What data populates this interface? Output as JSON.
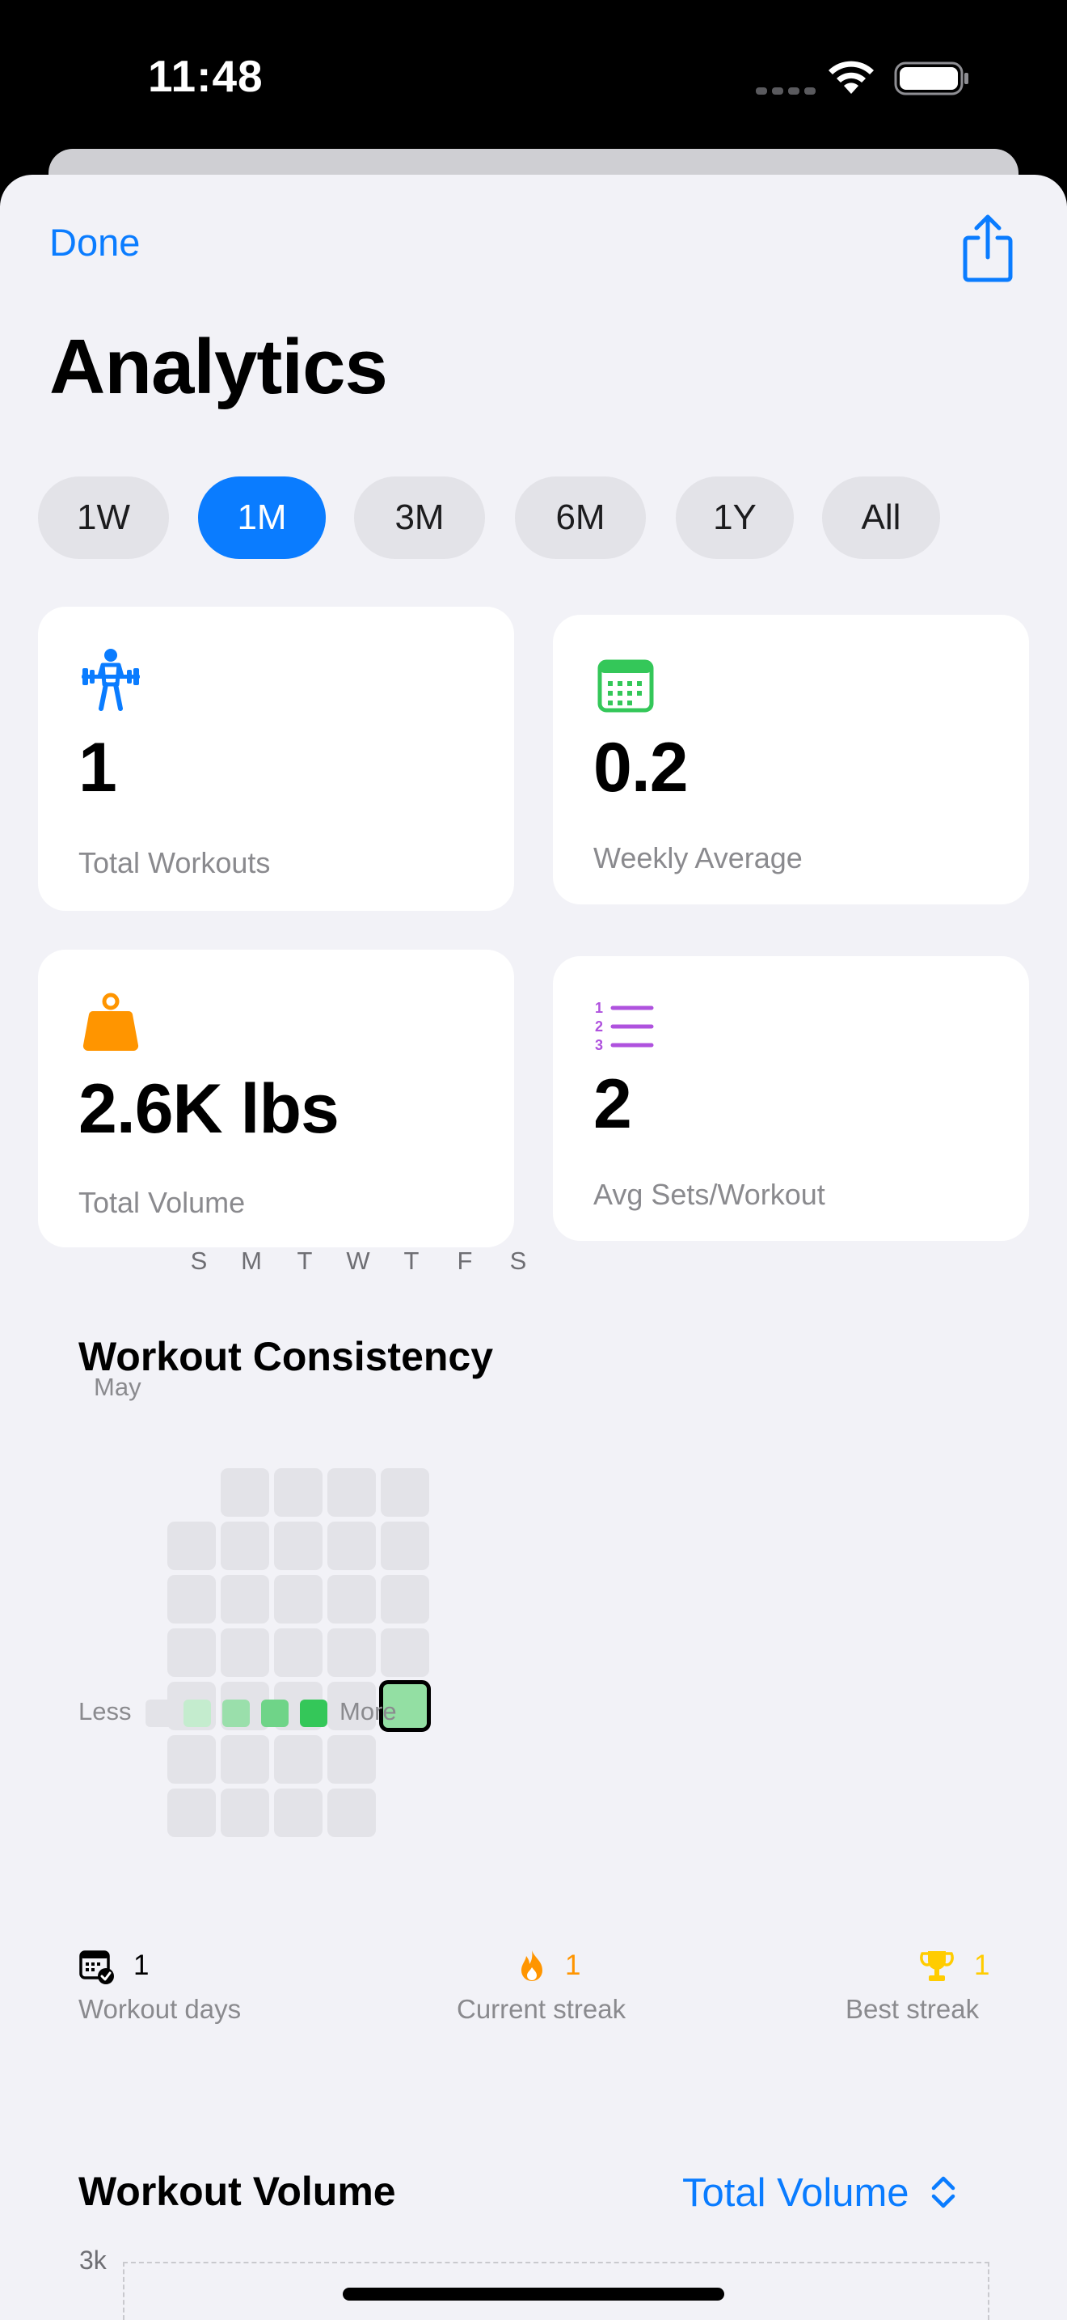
{
  "status_bar": {
    "time": "11:48"
  },
  "header": {
    "done_label": "Done",
    "title": "Analytics"
  },
  "range_tabs": [
    {
      "label": "1W",
      "active": false
    },
    {
      "label": "1M",
      "active": true
    },
    {
      "label": "3M",
      "active": false
    },
    {
      "label": "6M",
      "active": false
    },
    {
      "label": "1Y",
      "active": false
    },
    {
      "label": "All",
      "active": false
    }
  ],
  "stats": {
    "total_workouts": {
      "value": "1",
      "label": "Total Workouts",
      "icon": "weightlifter-icon",
      "color": "#0a7cff"
    },
    "weekly_average": {
      "value": "0.2",
      "label": "Weekly Average",
      "icon": "calendar-icon",
      "color": "#34c759"
    },
    "total_volume": {
      "value": "2.6K lbs",
      "label": "Total Volume",
      "icon": "scale-weight-icon",
      "color": "#ff9500"
    },
    "avg_sets": {
      "value": "2",
      "label": "Avg Sets/Workout",
      "icon": "numbered-list-icon",
      "color": "#af52de"
    }
  },
  "consistency": {
    "title": "Workout Consistency",
    "weekdays": [
      "S",
      "M",
      "T",
      "W",
      "T",
      "F",
      "S"
    ],
    "month_label": "May",
    "legend_less": "Less",
    "legend_more": "More",
    "legend_colors": [
      "#e3e3e8",
      "#c4ecce",
      "#9adfab",
      "#6fd488",
      "#34c759"
    ],
    "workout_days": {
      "value": "1",
      "label": "Workout days",
      "icon": "calendar-check-icon"
    },
    "current_streak": {
      "value": "1",
      "label": "Current streak",
      "icon": "flame-icon",
      "color": "#ff9500"
    },
    "best_streak": {
      "value": "1",
      "label": "Best streak",
      "icon": "trophy-icon",
      "color": "#ffcc00"
    }
  },
  "volume": {
    "title": "Workout Volume",
    "picker_label": "Total Volume",
    "y_tick_top": "3k"
  }
}
